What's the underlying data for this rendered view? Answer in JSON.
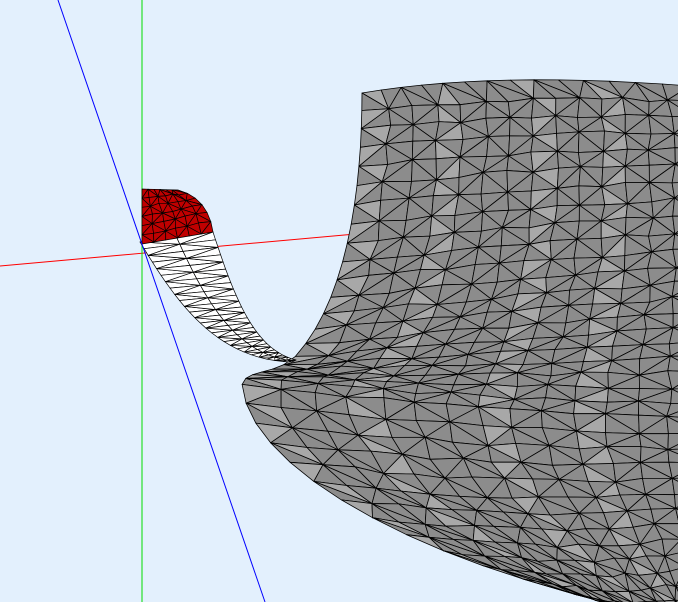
{
  "viewport": {
    "background": "#e3f0fd"
  },
  "axes": {
    "x_axis_color": "#ff0000",
    "y_axis_color": "#00dd00",
    "z_axis_color": "#0000ff"
  },
  "mesh": {
    "surface_fill": "#8c8c8c",
    "surface_shade": "#a8a8a8",
    "edge_color": "#000000",
    "selected_fill": "#c00000",
    "backface_fill": "#ffffff"
  }
}
